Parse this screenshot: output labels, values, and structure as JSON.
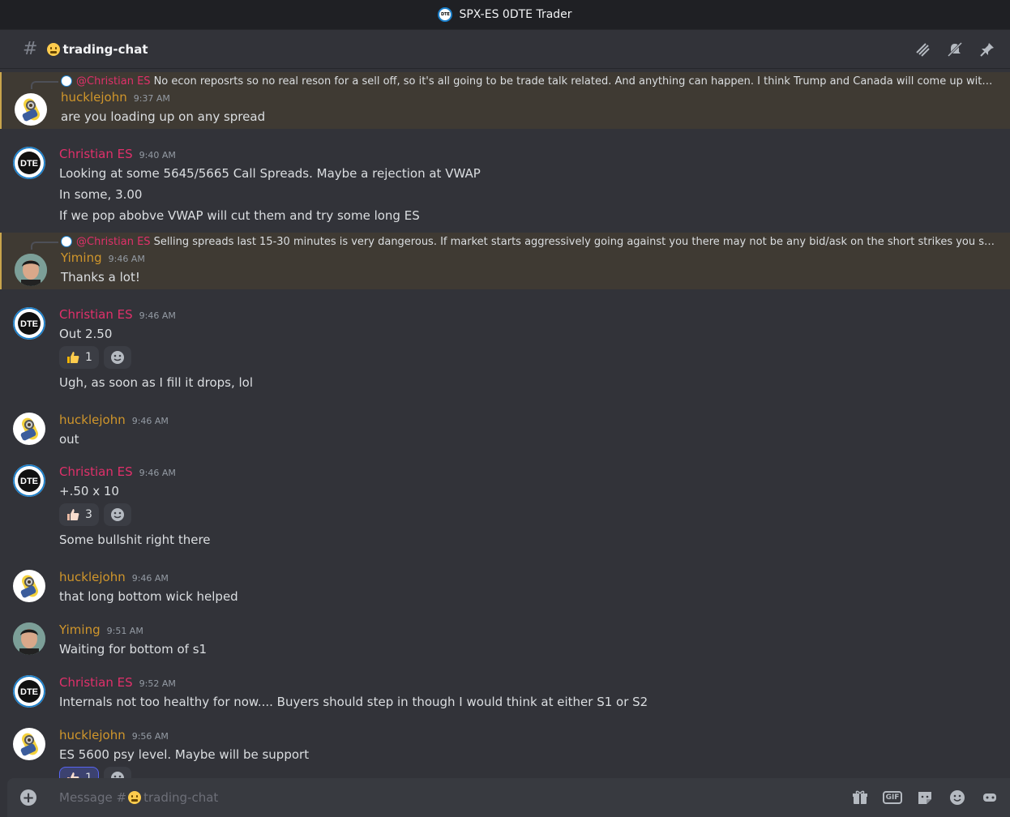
{
  "window": {
    "title": "SPX-ES 0DTE Trader",
    "logo_text": "DTE"
  },
  "channel": {
    "name": "trading-chat",
    "hash": "#"
  },
  "header_icons": [
    "threads-icon",
    "mute-icon",
    "pin-icon"
  ],
  "colors": {
    "hucklejohn": "#d0962b",
    "christian": "#e0306a",
    "yiming": "#d0962b",
    "highlight": "#3f3a33"
  },
  "messages": [
    {
      "author": "hucklejohn",
      "time": "9:37 AM",
      "highlight": true,
      "reply": {
        "mention": "@Christian ES",
        "text": "No econ reposrts so no real reson for a sell off, so it's all going to be trade talk related. And anything can happen. I think Trump and Canada will come up with some resolution."
      },
      "lines": [
        "are you loading up on any spread"
      ]
    },
    {
      "author": "Christian ES",
      "time": "9:40 AM",
      "lines": [
        "Looking at some 5645/5665 Call Spreads. Maybe a rejection at VWAP",
        "In some, 3.00",
        "If we pop abobve VWAP will cut them and try some long ES"
      ]
    },
    {
      "author": "Yiming",
      "time": "9:46 AM",
      "highlight": true,
      "reply": {
        "mention": "@Christian ES",
        "text": "Selling spreads last 15-30 minutes is very dangerous. If market starts aggressively going against you there may not be any bid/ask on the short strikes you sold, making it harder t..."
      },
      "lines": [
        "Thanks a lot!"
      ]
    },
    {
      "author": "Christian ES",
      "time": "9:46 AM",
      "lines": [
        "Out 2.50"
      ],
      "reaction_count": "1",
      "after": [
        "Ugh, as soon as I fill it drops, lol"
      ]
    },
    {
      "author": "hucklejohn",
      "time": "9:46 AM",
      "lines": [
        "out"
      ]
    },
    {
      "author": "Christian ES",
      "time": "9:46 AM",
      "lines": [
        "+.50 x 10"
      ],
      "reaction_count": "3",
      "after": [
        "Some bullshit right there"
      ]
    },
    {
      "author": "hucklejohn",
      "time": "9:46 AM",
      "lines": [
        "that long bottom wick helped"
      ]
    },
    {
      "author": "Yiming",
      "time": "9:51 AM",
      "lines": [
        "Waiting for bottom of s1"
      ]
    },
    {
      "author": "Christian ES",
      "time": "9:52 AM",
      "lines": [
        "Internals not too healthy for now.... Buyers should step in though I would think at either S1 or S2"
      ]
    },
    {
      "author": "hucklejohn",
      "time": "9:56 AM",
      "lines": [
        "ES 5600 psy level. Maybe will be support"
      ],
      "reaction_count": "1"
    }
  ],
  "composer": {
    "placeholder_prefix": "Message #",
    "placeholder_channel": "trading-chat"
  }
}
